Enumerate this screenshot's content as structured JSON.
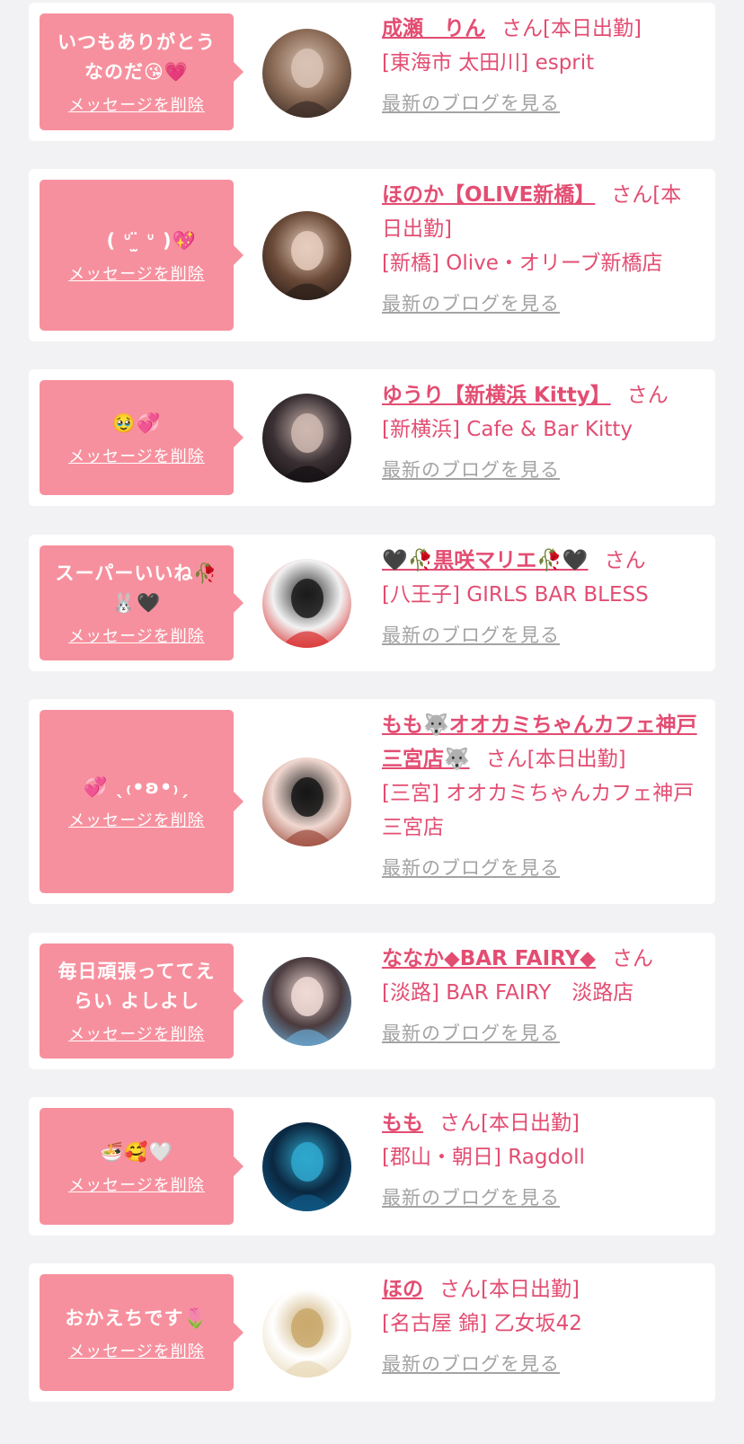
{
  "cards": [
    {
      "message": "いつもありがとうなのだ😘💗",
      "delete_label": "メッセージを削除",
      "name": "成瀬　りん",
      "honorific": "さん",
      "status": "[本日出勤]",
      "shop": "[東海市 太田川] esprit",
      "blog_label": "最新のブログを見る",
      "avatar_colors": [
        "#3a2c26",
        "#d9c3b5",
        "#8a6a55"
      ]
    },
    {
      "message": "‪ ‪ ‪ ‪ ‪( ᐡ ̫̈ ᐡ )💖",
      "delete_label": "メッセージを削除",
      "name": "ほのか【OLIVE新橋】",
      "honorific": "さん",
      "status": "[本日出勤]",
      "shop": "[新橋] Olive・オリーブ新橋店",
      "blog_label": "最新のブログを見る",
      "avatar_colors": [
        "#2a1e18",
        "#e6cdbd",
        "#6b4a38"
      ]
    },
    {
      "message": "🥹💞",
      "delete_label": "メッセージを削除",
      "name": "ゆうり【新横浜 Kitty】",
      "honorific": "さん",
      "status": "",
      "shop": "[新横浜] Cafe & Bar Kitty",
      "blog_label": "最新のブログを見る",
      "avatar_colors": [
        "#141012",
        "#cfb8b0",
        "#3a3034"
      ]
    },
    {
      "message": "スーパーいいね🥀🐰🖤",
      "delete_label": "メッセージを削除",
      "name": "🖤🥀黒咲マリエ🥀🖤",
      "honorific": "さん",
      "status": "",
      "shop": "[八王子] GIRLS BAR BLESS",
      "blog_label": "最新のブログを見る",
      "avatar_colors": [
        "#d82c2c",
        "#1a1a1a",
        "#f2f2f2"
      ]
    },
    {
      "message": "💞 ˎ₍•ʚ•₎ˏ",
      "delete_label": "メッセージを削除",
      "name": "もも🐺オオカミちゃんカフェ神戸三宮店🐺",
      "honorific": "さん",
      "status": "[本日出勤]",
      "shop": "[三宮] オオカミちゃんカフェ神戸三宮店",
      "blog_label": "最新のブログを見る",
      "avatar_colors": [
        "#9c4a3c",
        "#151515",
        "#f0d8d0"
      ]
    },
    {
      "message": "毎日頑張っててえらい よしよし",
      "delete_label": "メッセージを削除",
      "name": "ななか◆BAR FAIRY◆",
      "honorific": "さん",
      "status": "",
      "shop": "[淡路] BAR FAIRY　淡路店",
      "blog_label": "最新のブログを見る",
      "avatar_colors": [
        "#6aa6cf",
        "#f1dbd6",
        "#4b3b3e"
      ]
    },
    {
      "message": "🍜🥰🤍",
      "delete_label": "メッセージを削除",
      "name": "もも",
      "honorific": "さん",
      "status": "[本日出勤]",
      "shop": "[郡山・朝日] Ragdoll",
      "blog_label": "最新のブログを見る",
      "avatar_colors": [
        "#0f5a86",
        "#2fa8cf",
        "#0b2740"
      ]
    },
    {
      "message": "おかえちです🌷",
      "delete_label": "メッセージを削除",
      "name": "ほの",
      "honorific": "さん",
      "status": "[本日出勤]",
      "shop": "[名古屋 錦] 乙女坂42",
      "blog_label": "最新のブログを見る",
      "avatar_colors": [
        "#e8d9b8",
        "#c9a86b",
        "#ffffff"
      ]
    }
  ]
}
